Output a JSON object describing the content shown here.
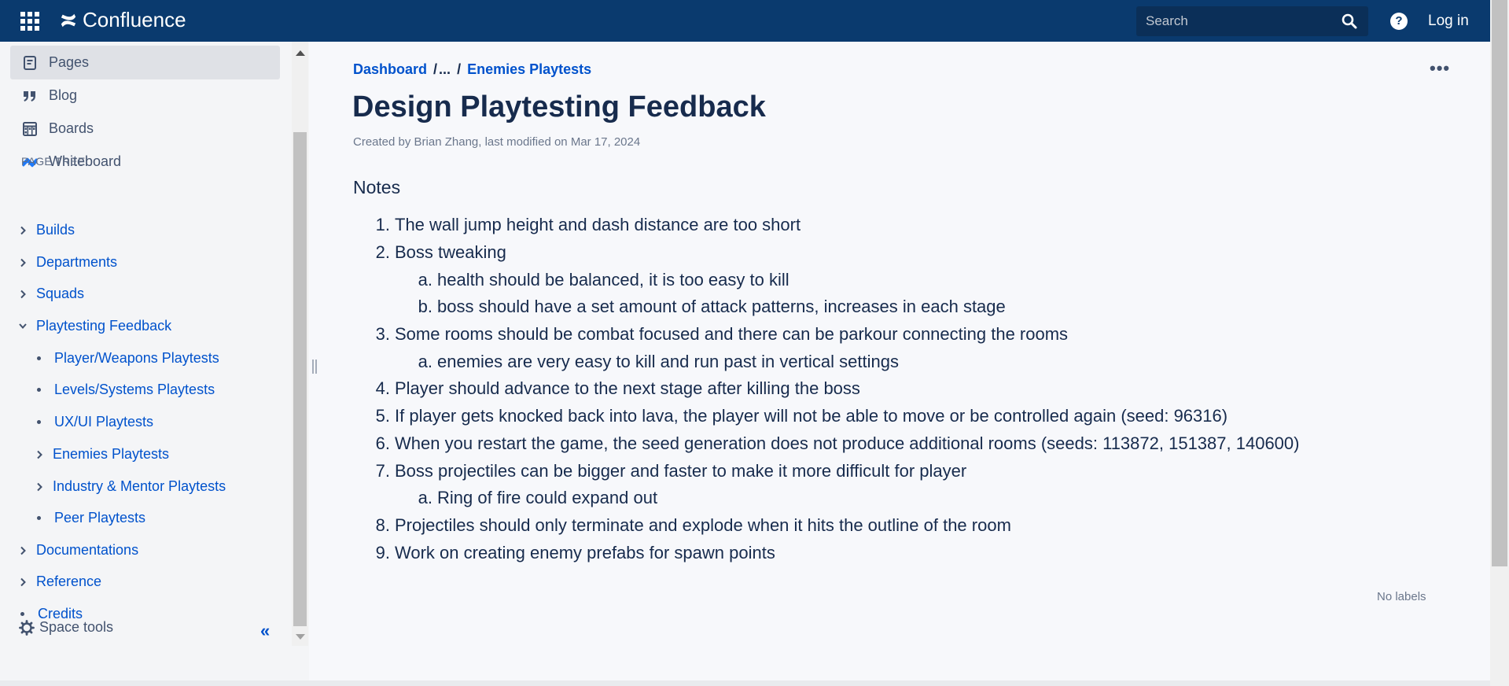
{
  "header": {
    "app_name": "Confluence",
    "search_placeholder": "Search",
    "help_label": "?",
    "login_label": "Log in"
  },
  "sidebar": {
    "nav": [
      {
        "label": "Pages",
        "icon": "pages-icon",
        "active": true
      },
      {
        "label": "Blog",
        "icon": "blog-quote-icon",
        "active": false
      },
      {
        "label": "Boards",
        "icon": "boards-icon",
        "active": false
      },
      {
        "label": "Whiteboard",
        "icon": "whiteboard-icon",
        "active": false
      }
    ],
    "page_tree_heading": "PAGE TREE",
    "tree": [
      {
        "label": "Builds",
        "marker": "chevron-right"
      },
      {
        "label": "Departments",
        "marker": "chevron-right"
      },
      {
        "label": "Squads",
        "marker": "chevron-right"
      },
      {
        "label": "Playtesting Feedback",
        "marker": "chevron-down"
      },
      {
        "label": "Player/Weapons Playtests",
        "marker": "bullet"
      },
      {
        "label": "Levels/Systems Playtests",
        "marker": "bullet"
      },
      {
        "label": "UX/UI Playtests",
        "marker": "bullet"
      },
      {
        "label": "Enemies Playtests",
        "marker": "chevron-right"
      },
      {
        "label": "Industry & Mentor Playtests",
        "marker": "chevron-right"
      },
      {
        "label": "Peer Playtests",
        "marker": "bullet"
      },
      {
        "label": "Documentations",
        "marker": "chevron-right"
      },
      {
        "label": "Reference",
        "marker": "chevron-right"
      },
      {
        "label": "Credits",
        "marker": "bullet"
      }
    ],
    "space_tools_label": "Space tools",
    "collapse_label": "«"
  },
  "breadcrumb": {
    "root": "Dashboard",
    "ellipsis": "...",
    "separator": "/",
    "parent": "Enemies Playtests"
  },
  "page": {
    "more_label": "•••",
    "title": "Design Playtesting Feedback",
    "byline": "Created by Brian Zhang, last modified on Mar 17, 2024",
    "notes_heading": "Notes",
    "no_labels": "No labels"
  },
  "notes": [
    {
      "num": "1.",
      "text": "The wall jump height and dash distance are too short",
      "level": 1
    },
    {
      "num": "2.",
      "text": "Boss tweaking",
      "level": 1
    },
    {
      "num": "a.",
      "text": "health should be balanced, it is too easy to kill",
      "level": 2
    },
    {
      "num": "b.",
      "text": "boss should have a set amount of attack patterns, increases in each stage",
      "level": 2
    },
    {
      "num": "3.",
      "text": "Some rooms should be combat focused and there can be parkour connecting the rooms",
      "level": 1
    },
    {
      "num": "a.",
      "text": "enemies are very easy to kill and run past in vertical settings",
      "level": 2
    },
    {
      "num": "4.",
      "text": "Player should advance to the next stage after killing the boss",
      "level": 1
    },
    {
      "num": "5.",
      "text": "If player gets knocked back into lava, the player will not be able to move or be controlled again (seed: 96316)",
      "level": 1
    },
    {
      "num": "6.",
      "text": "When you restart the game, the seed generation does not produce additional rooms (seeds: 113872, 151387, 140600)",
      "level": 1
    },
    {
      "num": "7.",
      "text": "Boss projectiles can be bigger and faster to make it more difficult for player",
      "level": 1
    },
    {
      "num": "a.",
      "text": "Ring of fire could expand out",
      "level": 2
    },
    {
      "num": "8.",
      "text": "Projectiles should only terminate and explode when it hits the outline of the room",
      "level": 1
    },
    {
      "num": "9.",
      "text": "Work on creating enemy prefabs for spawn points",
      "level": 1
    }
  ],
  "colors": {
    "topbar": "#0a3a6e",
    "link": "#0052cc",
    "text": "#172b4d"
  }
}
